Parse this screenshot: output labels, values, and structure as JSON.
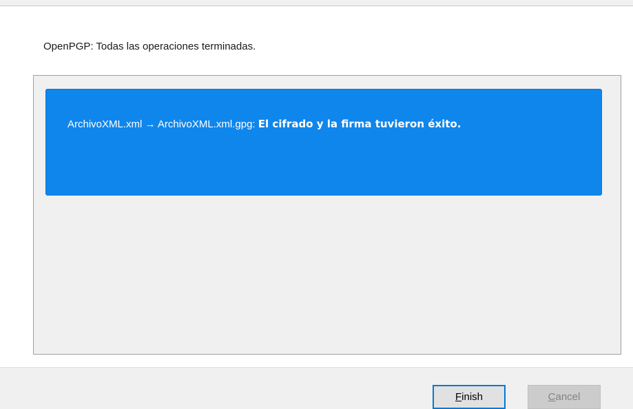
{
  "dialog": {
    "heading": "OpenPGP: Todas las operaciones terminadas."
  },
  "results": [
    {
      "source": "ArchivoXML.xml",
      "arrow": "→",
      "target": "ArchivoXML.xml.gpg:",
      "status": "El cifrado y la firma tuvieron éxito.",
      "color": "#0f86ec"
    }
  ],
  "buttons": {
    "finish": {
      "mnemonic": "F",
      "rest": "inish",
      "enabled": true
    },
    "cancel": {
      "mnemonic": "C",
      "rest": "ancel",
      "enabled": false
    }
  },
  "colors": {
    "accent": "#0078d7",
    "success_card": "#0f86ec"
  }
}
